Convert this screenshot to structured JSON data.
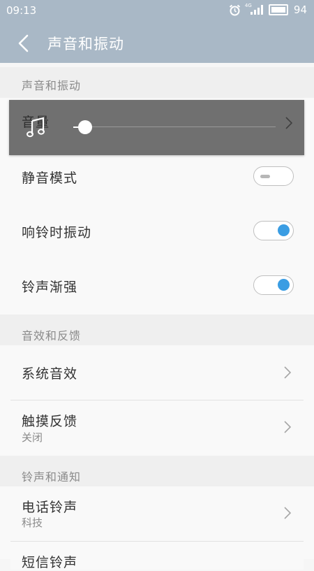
{
  "status": {
    "time": "09:13",
    "network": "4G",
    "battery": "94"
  },
  "appbar": {
    "title": "声音和振动"
  },
  "sections": {
    "sound": "声音和振动",
    "effects": "音效和反馈",
    "ringtones": "铃声和通知"
  },
  "volume": {
    "label": "音量",
    "level": 0.06
  },
  "rows": {
    "silent": {
      "label": "静音模式",
      "on": false
    },
    "vibrate": {
      "label": "响铃时振动",
      "on": true
    },
    "crescendo": {
      "label": "铃声渐强",
      "on": true
    },
    "system_sound": {
      "label": "系统音效"
    },
    "haptic": {
      "label": "触摸反馈",
      "sub": "关闭"
    },
    "phone_ringtone": {
      "label": "电话铃声",
      "sub": "科技"
    },
    "sms_ringtone": {
      "label": "短信铃声"
    }
  },
  "colors": {
    "accent": "#3a9de3",
    "appbar": "#a9b8c6"
  }
}
